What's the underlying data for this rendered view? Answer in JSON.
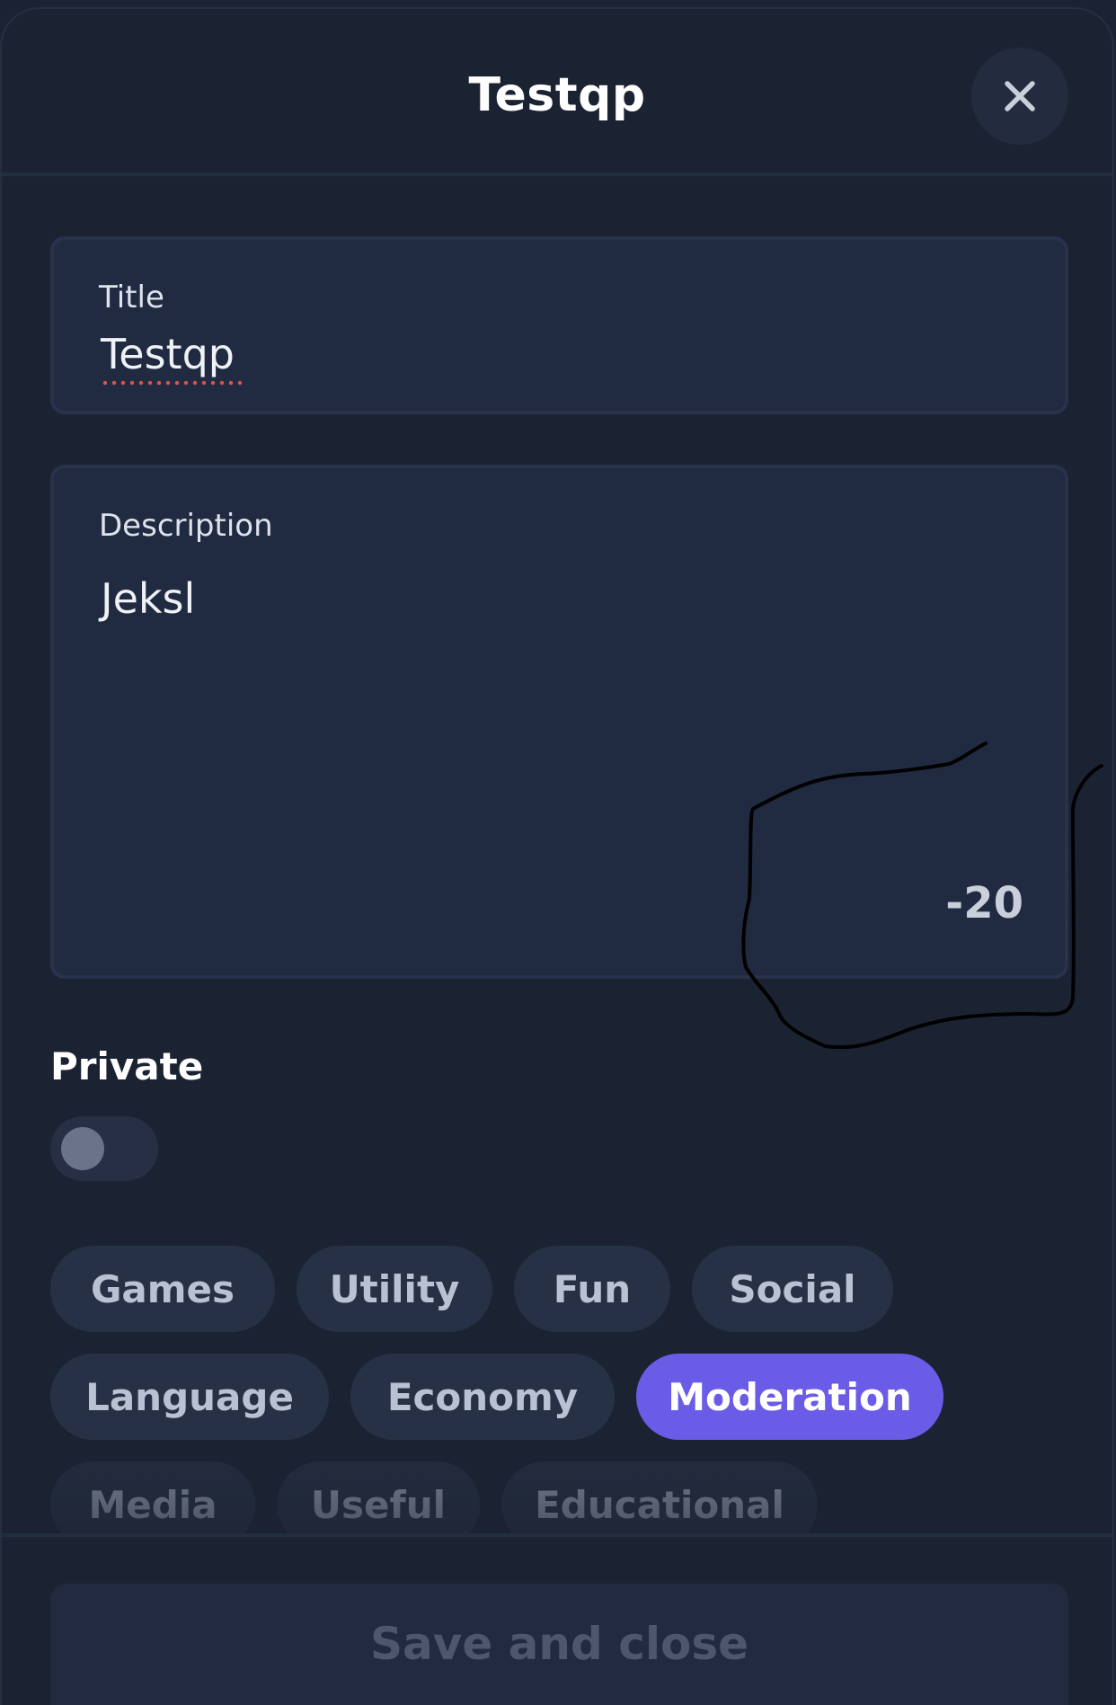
{
  "header": {
    "title": "Testqp",
    "close_icon": "close-icon"
  },
  "form": {
    "title_field": {
      "label": "Title",
      "value": "Testqp"
    },
    "description_field": {
      "label": "Description",
      "value": "Jeksl",
      "char_count": "-20"
    },
    "private": {
      "label": "Private",
      "enabled": false
    }
  },
  "tags": [
    {
      "label": "Games",
      "selected": false
    },
    {
      "label": "Utility",
      "selected": false
    },
    {
      "label": "Fun",
      "selected": false
    },
    {
      "label": "Social",
      "selected": false
    },
    {
      "label": "Language",
      "selected": false
    },
    {
      "label": "Economy",
      "selected": false
    },
    {
      "label": "Moderation",
      "selected": true
    },
    {
      "label": "Media",
      "selected": false
    },
    {
      "label": "Useful",
      "selected": false
    },
    {
      "label": "Educational",
      "selected": false
    }
  ],
  "footer": {
    "save_label": "Save and close"
  },
  "colors": {
    "background": "#1b2333",
    "field": "#202a40",
    "chip": "#273145",
    "accent": "#6b5ce7"
  }
}
